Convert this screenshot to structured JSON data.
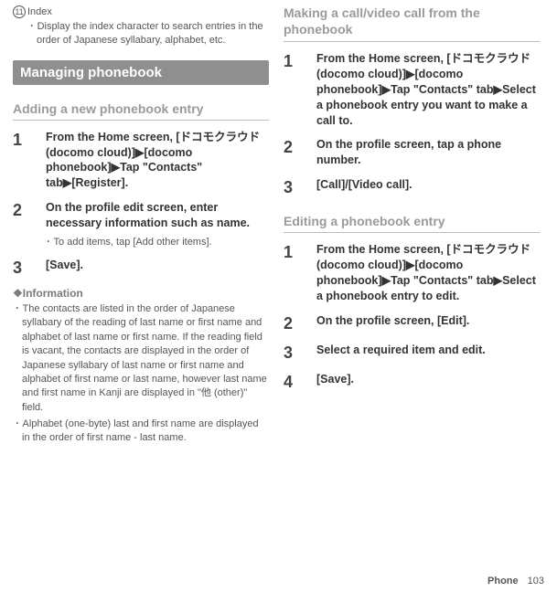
{
  "left": {
    "index_num": "11",
    "index_label": "Index",
    "index_bullet": "Display the index character to search entries in the order of Japanese syllabary, alphabet, etc.",
    "section_bar": "Managing phonebook",
    "sub_head1": "Adding a new phonebook entry",
    "step1_num": "1",
    "step1_body": "From the Home screen, [ドコモクラウド (docomo cloud)]▶[docomo phonebook]▶Tap \"Contacts\" tab▶[Register].",
    "step2_num": "2",
    "step2_body": "On the profile edit screen, enter necessary information such as name.",
    "step2_sub": "･ To add items, tap [Add other items].",
    "step3_num": "3",
    "step3_body": "[Save].",
    "info_head": "❖Information",
    "info_b1": "･ The contacts are listed in the order of Japanese syllabary of the reading of last name or first name and alphabet of last name or first name. If the reading field is vacant, the contacts are displayed in the order of Japanese syllabary of last name or first name and alphabet of first name or last name, however last name and first name in Kanji are displayed in \"他 (other)\" field.",
    "info_b2": "･ Alphabet (one-byte) last and first name are displayed in the order of first name - last name."
  },
  "right": {
    "top_head": "Making a call/video call from the phonebook",
    "r1_num": "1",
    "r1_body": "From the Home screen, [ドコモクラウド (docomo cloud)]▶[docomo phonebook]▶Tap \"Contacts\" tab▶Select a phonebook entry you want to make a call to.",
    "r2_num": "2",
    "r2_body": "On the profile screen, tap a phone number.",
    "r3_num": "3",
    "r3_body": "[Call]/[Video call].",
    "edit_head": "Editing a phonebook entry",
    "e1_num": "1",
    "e1_body": "From the Home screen, [ドコモクラウド (docomo cloud)]▶[docomo phonebook]▶Tap \"Contacts\" tab▶Select a phonebook entry to edit.",
    "e2_num": "2",
    "e2_body": "On the profile screen, [Edit].",
    "e3_num": "3",
    "e3_body": "Select a required item and edit.",
    "e4_num": "4",
    "e4_body": "[Save]."
  },
  "footer_label": "Phone",
  "footer_page": "103"
}
